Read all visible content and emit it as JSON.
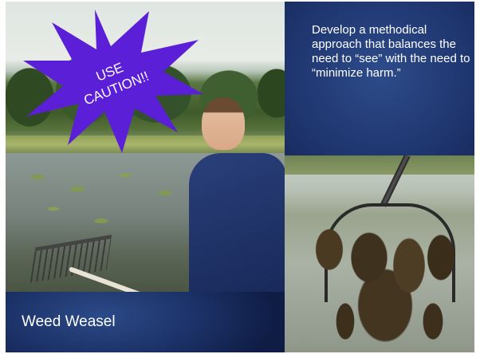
{
  "burst": {
    "line1": "USE",
    "line2": "CAUTION!!",
    "color": "#5a1fd6"
  },
  "panel": {
    "text": "Develop a methodical approach that balances the need to “see” with the need to “minimize harm.”"
  },
  "caption": {
    "text": "Weed Weasel"
  }
}
